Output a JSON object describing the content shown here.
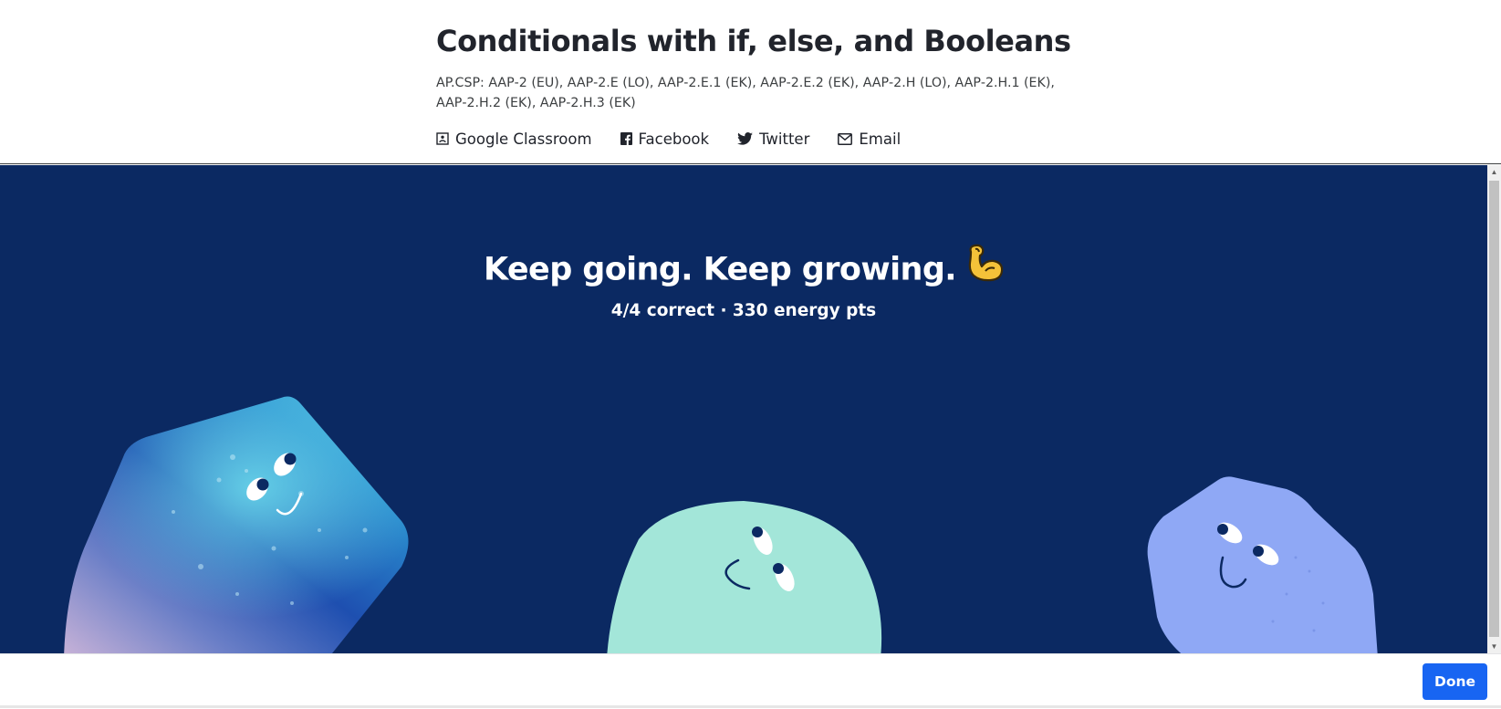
{
  "header": {
    "title": "Conditionals with if, else, and Booleans",
    "standards": "AP.CSP: AAP‑2 (EU), AAP‑2.E (LO), AAP‑2.E.1 (EK), AAP‑2.E.2 (EK), AAP‑2.H (LO), AAP‑2.H.1 (EK), AAP‑2.H.2 (EK), AAP‑2.H.3 (EK)",
    "share": [
      {
        "label": "Google Classroom",
        "icon": "google-classroom-icon"
      },
      {
        "label": "Facebook",
        "icon": "facebook-icon"
      },
      {
        "label": "Twitter",
        "icon": "twitter-icon"
      },
      {
        "label": "Email",
        "icon": "email-icon"
      }
    ]
  },
  "summary": {
    "headline": "Keep going. Keep growing.",
    "emoji": "flexed-biceps-icon",
    "score": "4/4 correct · 330 energy pts"
  },
  "footer": {
    "done_label": "Done"
  },
  "colors": {
    "stage_bg": "#0b2962",
    "accent": "#1865f2",
    "creature_mint": "#a3e6d9",
    "creature_periwinkle": "#8fa8f5",
    "creature_cosmic": "#1f5fc4"
  }
}
